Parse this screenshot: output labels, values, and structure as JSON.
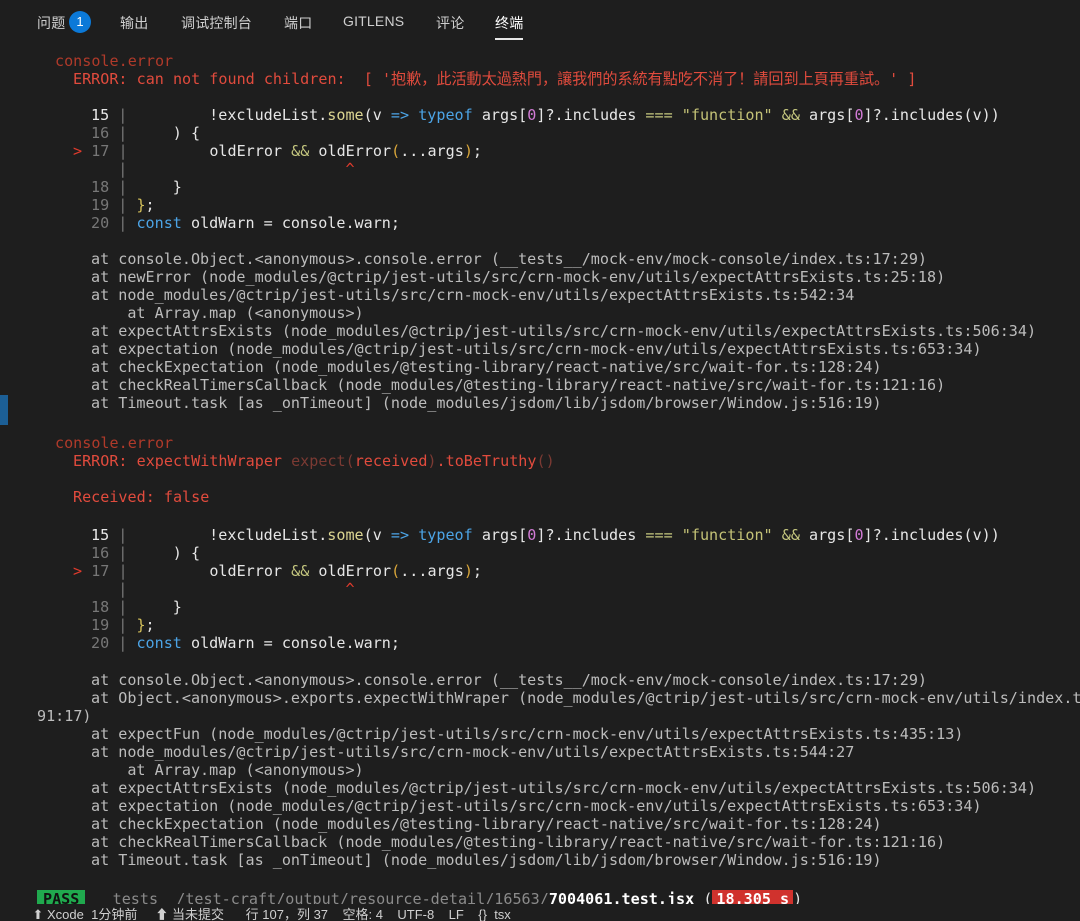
{
  "tabs": [
    {
      "label": "问题",
      "badge": "1"
    },
    {
      "label": "输出"
    },
    {
      "label": "调试控制台"
    },
    {
      "label": "端口"
    },
    {
      "label": "GITLENS"
    },
    {
      "label": "评论"
    },
    {
      "label": "终端"
    }
  ],
  "block1": {
    "console_error": "console.error",
    "error_line": "ERROR: can not found children:  [ '抱歉，此活動太過熱門，讓我們的系統有點吃不消了！請回到上頁再重試。' ]",
    "code": {
      "l15_num": "15",
      "l15": "        !excludeList.some(v => typeof args[0]?.includes === \"function\" && args[0]?.includes(v))",
      "l16_num": "16",
      "l16": "    ) {",
      "l17_marker": ">",
      "l17_num": "17",
      "l17": "        oldError && oldError(...args);",
      "caret": "^",
      "l18_num": "18",
      "l18": "    }",
      "l19_num": "19",
      "l19": "};",
      "l20_num": "20",
      "l20": "const oldWarn = console.warn;"
    },
    "stack": [
      "at console.Object.<anonymous>.console.error (__tests__/mock-env/mock-console/index.ts:17:29)",
      "at newError (node_modules/@ctrip/jest-utils/src/crn-mock-env/utils/expectAttrsExists.ts:25:18)",
      "at node_modules/@ctrip/jest-utils/src/crn-mock-env/utils/expectAttrsExists.ts:542:34",
      "    at Array.map (<anonymous>)",
      "at expectAttrsExists (node_modules/@ctrip/jest-utils/src/crn-mock-env/utils/expectAttrsExists.ts:506:34)",
      "at expectation (node_modules/@ctrip/jest-utils/src/crn-mock-env/utils/expectAttrsExists.ts:653:34)",
      "at checkExpectation (node_modules/@testing-library/react-native/src/wait-for.ts:128:24)",
      "at checkRealTimersCallback (node_modules/@testing-library/react-native/src/wait-for.ts:121:16)",
      "at Timeout.task [as _onTimeout] (node_modules/jsdom/lib/jsdom/browser/Window.js:516:19)"
    ]
  },
  "block2": {
    "console_error": "console.error",
    "error_prefix": "ERROR: expectWithWraper ",
    "error_expect": "expect(",
    "error_received": "received",
    "error_close": ")",
    "error_tail": ".toBeTruthy",
    "error_parens": "()",
    "received_line": "Received: false",
    "stack": [
      "at console.Object.<anonymous>.console.error (__tests__/mock-env/mock-console/index.ts:17:29)",
      "at Object.<anonymous>.exports.expectWithWraper (node_modules/@ctrip/jest-utils/src/crn-mock-env/utils/index.ts:",
      "91:17)",
      "at expectFun (node_modules/@ctrip/jest-utils/src/crn-mock-env/utils/expectAttrsExists.ts:435:13)",
      "at node_modules/@ctrip/jest-utils/src/crn-mock-env/utils/expectAttrsExists.ts:544:27",
      "    at Array.map (<anonymous>)",
      "at expectAttrsExists (node_modules/@ctrip/jest-utils/src/crn-mock-env/utils/expectAttrsExists.ts:506:34)",
      "at expectation (node_modules/@ctrip/jest-utils/src/crn-mock-env/utils/expectAttrsExists.ts:653:34)",
      "at checkExpectation (node_modules/@testing-library/react-native/src/wait-for.ts:128:24)",
      "at checkRealTimersCallback (node_modules/@testing-library/react-native/src/wait-for.ts:121:16)",
      "at Timeout.task [as _onTimeout] (node_modules/jsdom/lib/jsdom/browser/Window.js:516:19)"
    ]
  },
  "result": {
    "pass": "PASS",
    "path": "__tests__/test-craft/output/resource-detail/16563/",
    "file": "7004061.test.jsx",
    "open": "(",
    "time": "18.305 s",
    "close": ")"
  },
  "statusbar": "         ⬆ Xcode  1分钟前     ⬆ 当未提交      行 107，列 37    空格: 4    UTF-8    LF    {}  tsx"
}
